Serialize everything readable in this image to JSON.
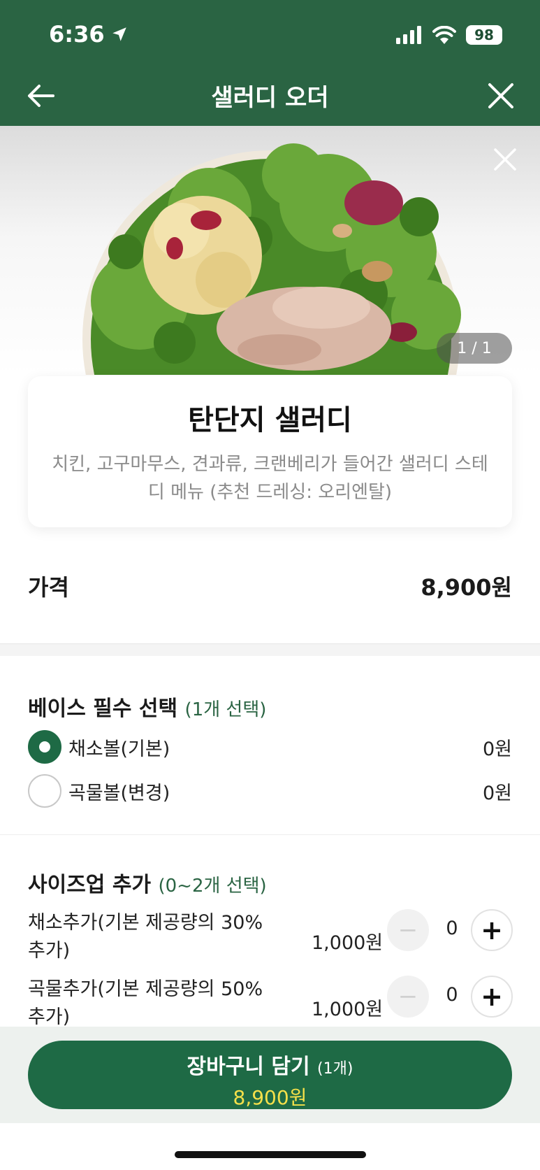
{
  "status_bar": {
    "time": "6:36",
    "battery": "98"
  },
  "nav": {
    "title": "샐러디 오더"
  },
  "hero": {
    "counter": "1 / 1"
  },
  "product": {
    "name": "탄단지 샐러디",
    "description": "치킨, 고구마무스, 견과류, 크랜베리가 들어간 샐러디 스테디 메뉴 (추천 드레싱: 오리엔탈)"
  },
  "price": {
    "label": "가격",
    "value": "8,900원"
  },
  "base_section": {
    "title": "베이스 필수 선택",
    "hint": "(1개 선택)",
    "options": [
      {
        "label": "채소볼(기본)",
        "price": "0원",
        "selected": true
      },
      {
        "label": "곡물볼(변경)",
        "price": "0원",
        "selected": false
      }
    ]
  },
  "sizeup_section": {
    "title": "사이즈업 추가",
    "hint": "(0~2개 선택)",
    "addons": [
      {
        "label": "채소추가(기본 제공량의 30% 추가)",
        "price": "1,000원",
        "qty": "0",
        "minus": "−",
        "plus": "+"
      },
      {
        "label": "곡물추가(기본 제공량의 50% 추가)",
        "price": "1,000원",
        "qty": "0",
        "minus": "−",
        "plus": "+"
      }
    ]
  },
  "cart_button": {
    "label": "장바구니 담기",
    "count": "(1개)",
    "total": "8,900원"
  },
  "colors": {
    "brand_green": "#2a6443",
    "button_green": "#1e6a45",
    "total_yellow": "#f4e04a"
  },
  "icons": [
    "location-arrow-icon",
    "signal-icon",
    "wifi-icon",
    "back-arrow-icon",
    "close-icon",
    "image-close-icon",
    "minus-icon",
    "plus-icon"
  ]
}
